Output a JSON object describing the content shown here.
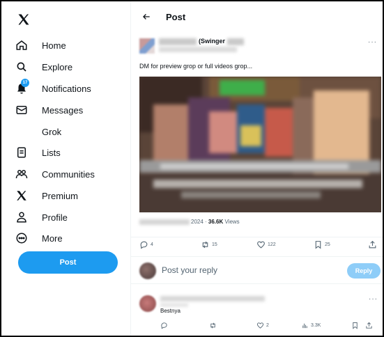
{
  "sidebar": {
    "logo": "x-logo",
    "items": [
      {
        "label": "Home",
        "icon": "home-icon"
      },
      {
        "label": "Explore",
        "icon": "search-icon"
      },
      {
        "label": "Notifications",
        "icon": "bell-icon",
        "badge": "17"
      },
      {
        "label": "Messages",
        "icon": "envelope-icon"
      },
      {
        "label": "Grok",
        "icon": "grok-icon"
      },
      {
        "label": "Lists",
        "icon": "list-icon"
      },
      {
        "label": "Communities",
        "icon": "communities-icon"
      },
      {
        "label": "Premium",
        "icon": "x-logo-icon"
      },
      {
        "label": "Profile",
        "icon": "person-icon"
      },
      {
        "label": "More",
        "icon": "more-circle-icon"
      }
    ],
    "post_button": "Post"
  },
  "header": {
    "title": "Post"
  },
  "tweet": {
    "author_visible": "(Swinger",
    "more": "···",
    "text": "DM for preview grop or full videos grop...",
    "meta_year": "2024 · ",
    "views_count": "36.6K",
    "views_label": " Views",
    "actions": {
      "replies": "4",
      "reposts": "15",
      "likes": "122",
      "bookmarks": "25"
    }
  },
  "reply_box": {
    "placeholder": "Post your reply",
    "button": "Reply"
  },
  "comment": {
    "text": "Bestnya",
    "more": "···",
    "actions": {
      "reposts": "",
      "likes": "2",
      "views": "3.3K"
    }
  },
  "colors": {
    "accent": "#1d9bf0",
    "reply_disabled": "#8ecdf8",
    "text_primary": "#0f1419",
    "text_secondary": "#536471"
  }
}
